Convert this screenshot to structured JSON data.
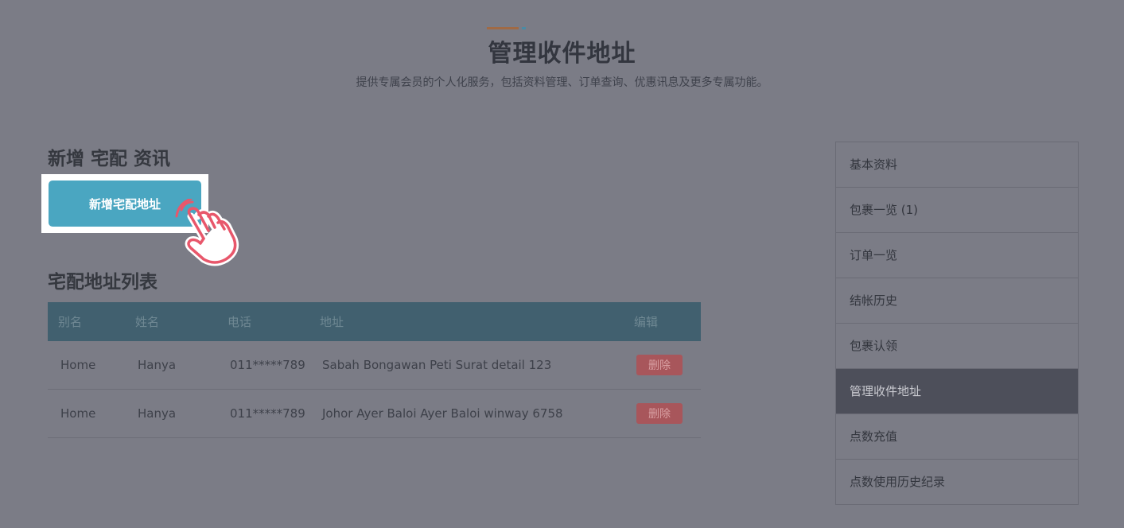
{
  "header": {
    "title": "管理收件地址",
    "subtitle": "提供专属会员的个人化服务，包括资料管理、订单查询、优惠讯息及更多专属功能。"
  },
  "add_section": {
    "title": "新增 宅配 资讯",
    "button_label": "新增宅配地址"
  },
  "list_section": {
    "title": "宅配地址列表",
    "columns": [
      "别名",
      "姓名",
      "电话",
      "地址",
      "编辑"
    ],
    "rows": [
      {
        "alias": "Home",
        "name": "Hanya",
        "phone": "011*****789",
        "address": "Sabah Bongawan Peti Surat detail 123",
        "action": "删除"
      },
      {
        "alias": "Home",
        "name": "Hanya",
        "phone": "011*****789",
        "address": "Johor Ayer Baloi Ayer Baloi winway 6758",
        "action": "删除"
      }
    ]
  },
  "sidebar": {
    "items": [
      {
        "label": "基本资料"
      },
      {
        "label": "包裹一览 (1)"
      },
      {
        "label": "订单一览"
      },
      {
        "label": "结帐历史"
      },
      {
        "label": "包裹认领"
      },
      {
        "label": "管理收件地址"
      },
      {
        "label": "点数充值"
      },
      {
        "label": "点数使用历史纪录"
      }
    ],
    "active_index": 5
  },
  "colors": {
    "overlay_bg": "#7b7c86",
    "button_blue": "#4aa6c1",
    "table_header": "#41606f",
    "delete_red": "#a8565b",
    "active_menu": "#4d4f5a",
    "hand_pink": "#e8576b"
  },
  "icons": {
    "pointer": "hand-pointer-icon"
  }
}
